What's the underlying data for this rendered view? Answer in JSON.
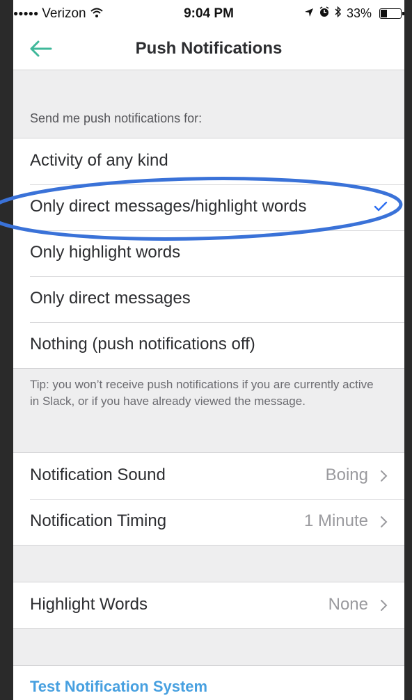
{
  "status_bar": {
    "carrier": "Verizon",
    "time": "9:04 PM",
    "battery_percent_label": "33%",
    "battery_level": 0.33,
    "icons": [
      "signal-dots-icon",
      "wifi-icon",
      "location-arrow-icon",
      "alarm-icon",
      "bluetooth-icon",
      "battery-icon"
    ]
  },
  "nav": {
    "title": "Push Notifications",
    "back_icon": "arrow-left-icon"
  },
  "notify_section": {
    "header": "Send me push notifications for:",
    "options": [
      {
        "label": "Activity of any kind",
        "selected": false
      },
      {
        "label": "Only direct messages/highlight words",
        "selected": true
      },
      {
        "label": "Only highlight words",
        "selected": false
      },
      {
        "label": "Only direct messages",
        "selected": false
      },
      {
        "label": "Nothing (push notifications off)",
        "selected": false
      }
    ],
    "tip": "Tip: you won’t receive push notifications if you are currently active in Slack, or if you have already viewed the message."
  },
  "sound_timing": [
    {
      "label": "Notification Sound",
      "value": "Boing"
    },
    {
      "label": "Notification Timing",
      "value": "1 Minute"
    }
  ],
  "highlight_words": {
    "label": "Highlight Words",
    "value": "None"
  },
  "test_link": "Test Notification System",
  "colors": {
    "accent_green": "#3fb89a",
    "check_blue": "#2d6ff2",
    "annotation_blue": "#3a72d8",
    "link_blue": "#47a0e0"
  }
}
